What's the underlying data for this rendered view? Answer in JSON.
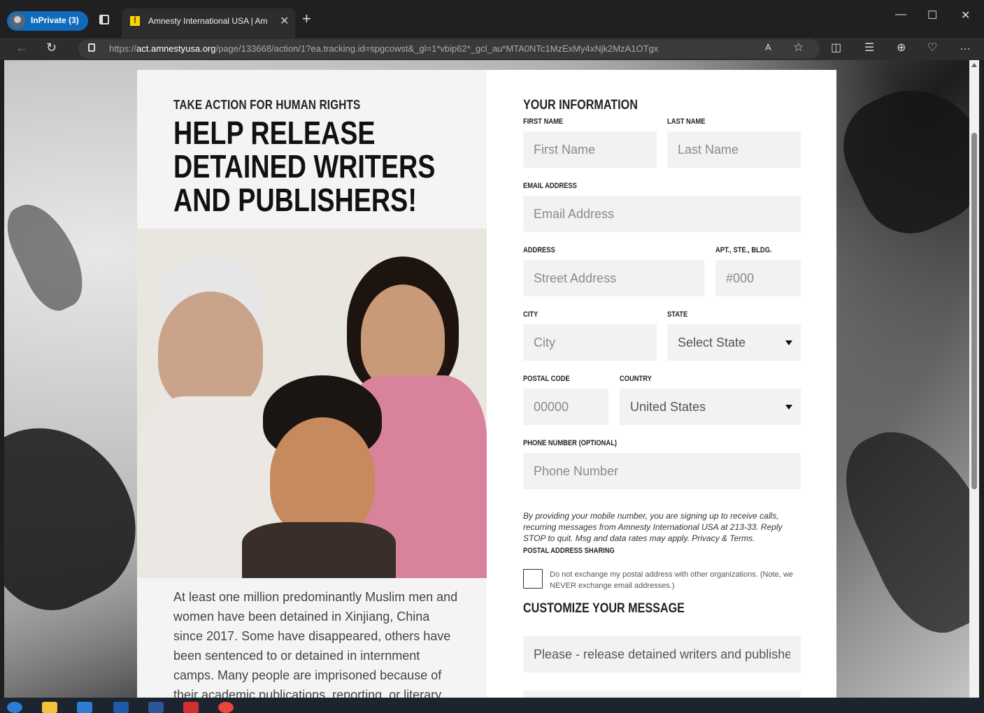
{
  "browser": {
    "inprivate_label": "InPrivate (3)",
    "tab_title": "Amnesty International USA | Am",
    "url_prefix": "https://",
    "url_domain": "act.amnestyusa.org",
    "url_path": "/page/133668/action/1?ea.tracking.id=spgcowst&_gl=1*vbip62*_gcl_au*MTA0NTc1MzExMy4xNjk2MzA1OTgx"
  },
  "left": {
    "kicker": "TAKE ACTION FOR HUMAN RIGHTS",
    "headline_line1": "HELP RELEASE",
    "headline_line2": "DETAINED WRITERS",
    "headline_line3": "AND PUBLISHERS!",
    "body": "At least one million predominantly Muslim men and women have been detained in Xinjiang, China since 2017. Some have disappeared, others have been sentenced to or detained in internment camps. Many people are imprisoned because of their academic publications, reporting, or literary"
  },
  "form": {
    "section_title": "YOUR INFORMATION",
    "first_name_label": "FIRST NAME",
    "first_name_placeholder": "First Name",
    "last_name_label": "LAST NAME",
    "last_name_placeholder": "Last Name",
    "email_label": "EMAIL ADDRESS",
    "email_placeholder": "Email Address",
    "address_label": "ADDRESS",
    "address_placeholder": "Street Address",
    "apt_label": "APT., STE., BLDG.",
    "apt_placeholder": "#000",
    "city_label": "CITY",
    "city_placeholder": "City",
    "state_label": "STATE",
    "state_value": "Select State",
    "postal_label": "POSTAL CODE",
    "postal_placeholder": "00000",
    "country_label": "COUNTRY",
    "country_value": "United States",
    "phone_label": "PHONE NUMBER (OPTIONAL)",
    "phone_placeholder": "Phone Number",
    "disclaimer": "By providing your mobile number, you are signing up to receive calls, recurring messages from Amnesty International USA at 213-33. Reply STOP to quit. Msg and data rates may apply. Privacy & Terms.",
    "sharing_label": "POSTAL ADDRESS SHARING",
    "sharing_text": "Do not exchange my postal address with other organizations. (Note, we NEVER exchange email addresses.)",
    "customize_title": "CUSTOMIZE YOUR MESSAGE",
    "message_value": "Please - release detained writers and publishers"
  },
  "colors": {
    "accent_blue": "#0f6cbd",
    "amnesty_yellow": "#ffd700"
  }
}
